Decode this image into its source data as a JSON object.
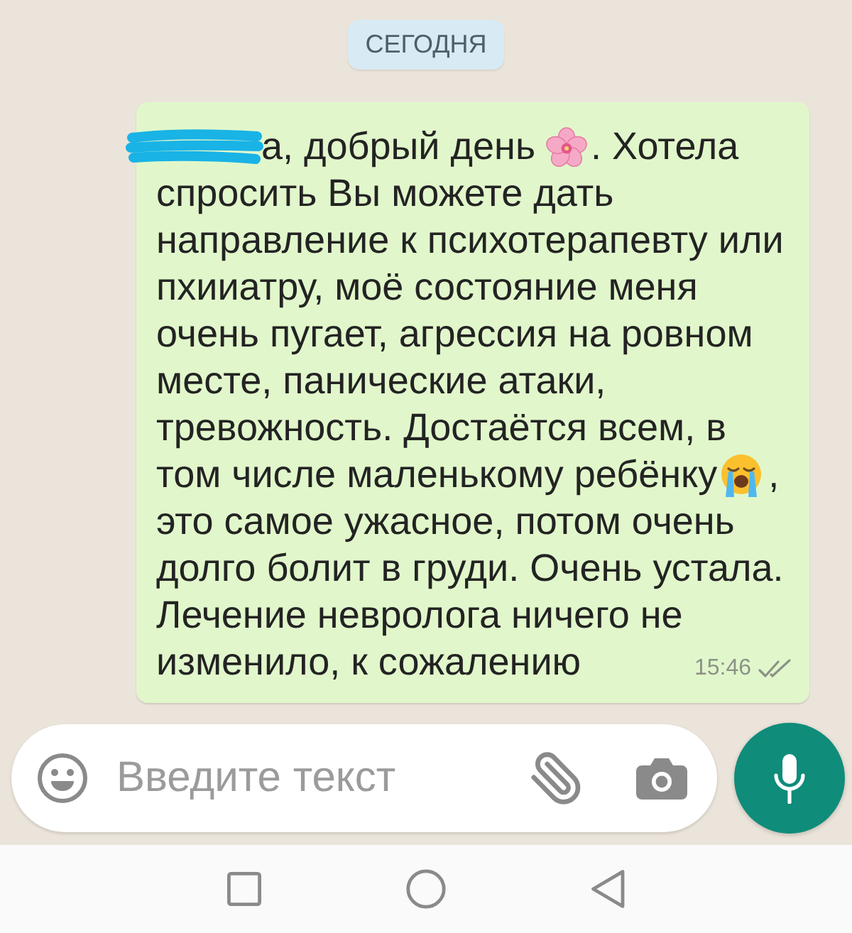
{
  "date_badge": {
    "label": "СЕГОДНЯ"
  },
  "message": {
    "lines": [
      [
        {
          "kind": "redaction"
        },
        {
          "kind": "text",
          "text": "а, добрый день"
        },
        {
          "kind": "blossom"
        },
        {
          "kind": "text",
          "text": ". Хотела"
        }
      ],
      [
        {
          "kind": "text",
          "text": "спросить Вы можете дать"
        }
      ],
      [
        {
          "kind": "text",
          "text": "направление к психотерапевту или"
        }
      ],
      [
        {
          "kind": "text",
          "text": "пхииатру, моё состояние меня"
        }
      ],
      [
        {
          "kind": "text",
          "text": "очень пугает, агрессия на ровном"
        }
      ],
      [
        {
          "kind": "text",
          "text": "месте, панические атаки,"
        }
      ],
      [
        {
          "kind": "text",
          "text": "тревожность. Достаётся всем, в"
        }
      ],
      [
        {
          "kind": "text",
          "text": "том числе маленькому ребёнку"
        },
        {
          "kind": "crying"
        },
        {
          "kind": "text",
          "text": ","
        }
      ],
      [
        {
          "kind": "text",
          "text": "это самое ужасное, потом очень"
        }
      ],
      [
        {
          "kind": "text",
          "text": "долго болит в груди. Очень устала."
        }
      ],
      [
        {
          "kind": "text",
          "text": "Лечение невролога ничего не"
        }
      ],
      [
        {
          "kind": "text",
          "text": "изменило, к сожалению"
        }
      ]
    ],
    "time": "15:46",
    "read": false
  },
  "composer": {
    "placeholder": "Введите текст"
  }
}
